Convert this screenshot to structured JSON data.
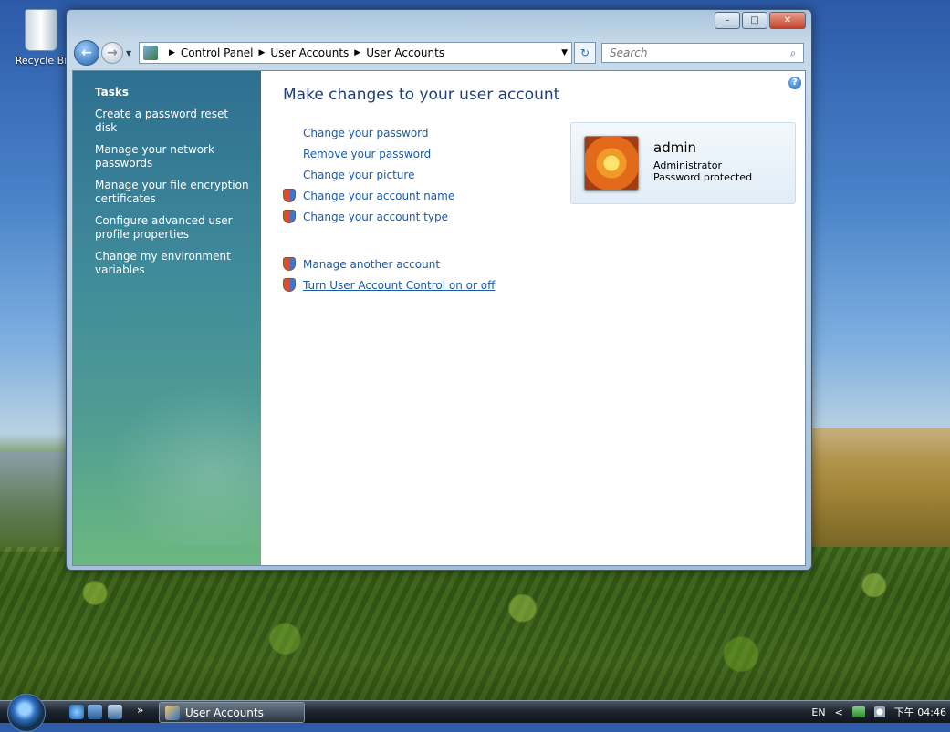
{
  "desktop": {
    "recycle_bin_label": "Recycle Bi"
  },
  "window": {
    "controls": {
      "minimize": "–",
      "maximize": "□",
      "close": "✕"
    },
    "address": {
      "crumbs": [
        "Control Panel",
        "User Accounts",
        "User Accounts"
      ]
    },
    "search": {
      "placeholder": "Search"
    }
  },
  "sidebar": {
    "title": "Tasks",
    "tasks": [
      "Create a password reset disk",
      "Manage your network passwords",
      "Manage your file encryption certificates",
      "Configure advanced user profile properties",
      "Change my environment variables"
    ]
  },
  "main": {
    "heading": "Make changes to your user account",
    "links": [
      {
        "label": "Change your password",
        "shield": false
      },
      {
        "label": "Remove your password",
        "shield": false
      },
      {
        "label": "Change your picture",
        "shield": false
      },
      {
        "label": "Change your account name",
        "shield": true
      },
      {
        "label": "Change your account type",
        "shield": true
      }
    ],
    "links2": [
      {
        "label": "Manage another account",
        "shield": true
      },
      {
        "label": "Turn User Account Control on or off",
        "shield": true,
        "hovered": true
      }
    ]
  },
  "user": {
    "name": "admin",
    "role": "Administrator",
    "status": "Password protected"
  },
  "taskbar": {
    "chevron": "»",
    "active_window": "User Accounts",
    "language": "EN",
    "tray_arrow": "<",
    "clock": "下午 04:46"
  },
  "colors": {
    "link": "#1a5aa8",
    "heading": "#1f3d7a",
    "sidebar_top": "#2e6f90",
    "sidebar_bottom": "#6cb880"
  }
}
